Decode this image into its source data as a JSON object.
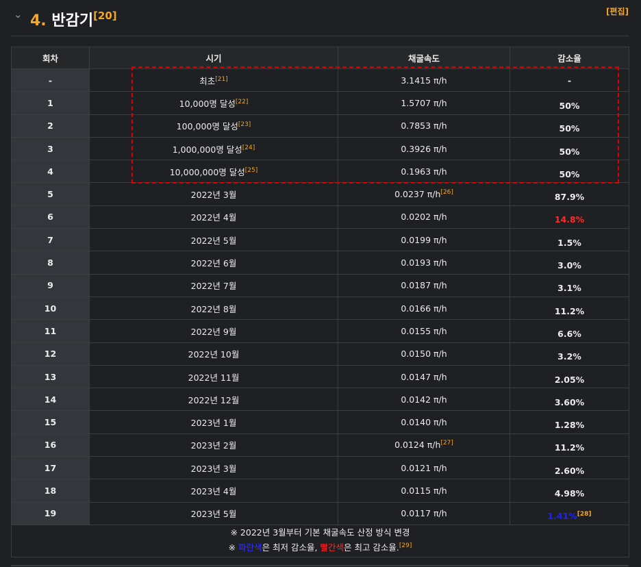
{
  "section": {
    "number": "4.",
    "title": "반감기",
    "ref": "[20]",
    "edit_label": "[편집]"
  },
  "table": {
    "headers": [
      "회차",
      "시기",
      "채굴속도",
      "감소율"
    ],
    "rows": [
      {
        "idx": "-",
        "period": "최초",
        "period_ref": "[21]",
        "rate": "3.1415 π/h",
        "rate_ref": "",
        "decrease": "-",
        "dec_ref": "",
        "dec_color": ""
      },
      {
        "idx": "1",
        "period": "10,000명 달성",
        "period_ref": "[22]",
        "rate": "1.5707 π/h",
        "rate_ref": "",
        "decrease": "50%",
        "dec_ref": "",
        "dec_color": ""
      },
      {
        "idx": "2",
        "period": "100,000명 달성",
        "period_ref": "[23]",
        "rate": "0.7853 π/h",
        "rate_ref": "",
        "decrease": "50%",
        "dec_ref": "",
        "dec_color": ""
      },
      {
        "idx": "3",
        "period": "1,000,000명 달성",
        "period_ref": "[24]",
        "rate": "0.3926 π/h",
        "rate_ref": "",
        "decrease": "50%",
        "dec_ref": "",
        "dec_color": ""
      },
      {
        "idx": "4",
        "period": "10,000,000명 달성",
        "period_ref": "[25]",
        "rate": "0.1963 π/h",
        "rate_ref": "",
        "decrease": "50%",
        "dec_ref": "",
        "dec_color": ""
      },
      {
        "idx": "5",
        "period": "2022년 3월",
        "period_ref": "",
        "rate": "0.0237 π/h",
        "rate_ref": "[26]",
        "decrease": "87.9%",
        "dec_ref": "",
        "dec_color": ""
      },
      {
        "idx": "6",
        "period": "2022년 4월",
        "period_ref": "",
        "rate": "0.0202 π/h",
        "rate_ref": "",
        "decrease": "14.8%",
        "dec_ref": "",
        "dec_color": "red"
      },
      {
        "idx": "7",
        "period": "2022년 5월",
        "period_ref": "",
        "rate": "0.0199 π/h",
        "rate_ref": "",
        "decrease": "1.5%",
        "dec_ref": "",
        "dec_color": ""
      },
      {
        "idx": "8",
        "period": "2022년 6월",
        "period_ref": "",
        "rate": "0.0193 π/h",
        "rate_ref": "",
        "decrease": "3.0%",
        "dec_ref": "",
        "dec_color": ""
      },
      {
        "idx": "9",
        "period": "2022년 7월",
        "period_ref": "",
        "rate": "0.0187 π/h",
        "rate_ref": "",
        "decrease": "3.1%",
        "dec_ref": "",
        "dec_color": ""
      },
      {
        "idx": "10",
        "period": "2022년 8월",
        "period_ref": "",
        "rate": "0.0166 π/h",
        "rate_ref": "",
        "decrease": "11.2%",
        "dec_ref": "",
        "dec_color": ""
      },
      {
        "idx": "11",
        "period": "2022년 9월",
        "period_ref": "",
        "rate": "0.0155 π/h",
        "rate_ref": "",
        "decrease": "6.6%",
        "dec_ref": "",
        "dec_color": ""
      },
      {
        "idx": "12",
        "period": "2022년 10월",
        "period_ref": "",
        "rate": "0.0150 π/h",
        "rate_ref": "",
        "decrease": "3.2%",
        "dec_ref": "",
        "dec_color": ""
      },
      {
        "idx": "13",
        "period": "2022년 11월",
        "period_ref": "",
        "rate": "0.0147 π/h",
        "rate_ref": "",
        "decrease": "2.05%",
        "dec_ref": "",
        "dec_color": ""
      },
      {
        "idx": "14",
        "period": "2022년 12월",
        "period_ref": "",
        "rate": "0.0142 π/h",
        "rate_ref": "",
        "decrease": "3.60%",
        "dec_ref": "",
        "dec_color": ""
      },
      {
        "idx": "15",
        "period": "2023년 1월",
        "period_ref": "",
        "rate": "0.0140 π/h",
        "rate_ref": "",
        "decrease": "1.28%",
        "dec_ref": "",
        "dec_color": ""
      },
      {
        "idx": "16",
        "period": "2023년 2월",
        "period_ref": "",
        "rate": "0.0124 π/h",
        "rate_ref": "[27]",
        "decrease": "11.2%",
        "dec_ref": "",
        "dec_color": ""
      },
      {
        "idx": "17",
        "period": "2023년 3월",
        "period_ref": "",
        "rate": "0.0121 π/h",
        "rate_ref": "",
        "decrease": "2.60%",
        "dec_ref": "",
        "dec_color": ""
      },
      {
        "idx": "18",
        "period": "2023년 4월",
        "period_ref": "",
        "rate": "0.0115 π/h",
        "rate_ref": "",
        "decrease": "4.98%",
        "dec_ref": "",
        "dec_color": ""
      },
      {
        "idx": "19",
        "period": "2023년 5월",
        "period_ref": "",
        "rate": "0.0117 π/h",
        "rate_ref": "",
        "decrease": "1.41%",
        "dec_ref": "[28]",
        "dec_color": "blue"
      }
    ],
    "footnote_line1": "※ 2022년 3월부터 기본 채굴속도 산정 방식 변경",
    "footnote_line2": {
      "prefix": "※ ",
      "blue_word": "파란색",
      "mid": "은 최저 감소율, ",
      "red_word": "빨간색",
      "suffix": "은 최고 감소율.",
      "ref": "[29]"
    }
  },
  "colors": {
    "accent": "#f5a623",
    "rate_header_bg": "#4b0082",
    "rate_header_text": "#ff6a1a",
    "highlight_box": "#e00000"
  }
}
